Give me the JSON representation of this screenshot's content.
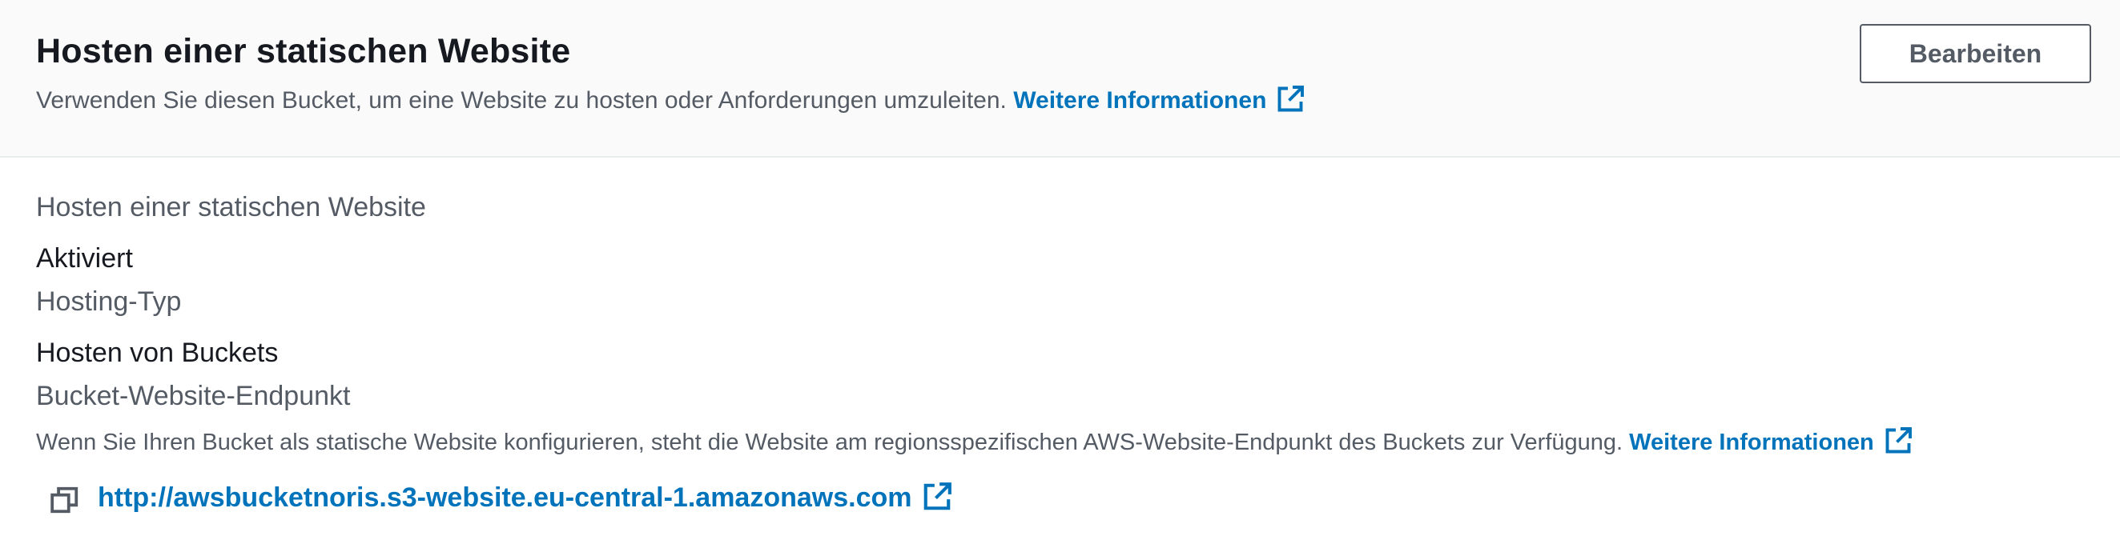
{
  "header": {
    "title": "Hosten einer statischen Website",
    "description": "Verwenden Sie diesen Bucket, um eine Website zu hosten oder Anforderungen umzuleiten.",
    "learn_more": "Weitere Informationen",
    "edit_label": "Bearbeiten",
    "external_icon": "external-link-icon"
  },
  "details": {
    "hosting_label": "Hosten einer statischen Website",
    "hosting_value": "Aktiviert",
    "type_label": "Hosting-Typ",
    "type_value": "Hosten von Buckets",
    "endpoint_label": "Bucket-Website-Endpunkt",
    "endpoint_hint": "Wenn Sie Ihren Bucket als statische Website konfigurieren, steht die Website am regionsspezifischen AWS-Website-Endpunkt des Buckets zur Verfügung.",
    "endpoint_learn_more": "Weitere Informationen",
    "endpoint_url": "http://awsbucketnoris.s3-website.eu-central-1.amazonaws.com",
    "copy_icon": "copy-icon"
  },
  "colors": {
    "link": "#0073bb",
    "text": "#16191f",
    "secondary_text": "#545b64",
    "header_bg": "#fafafa"
  }
}
